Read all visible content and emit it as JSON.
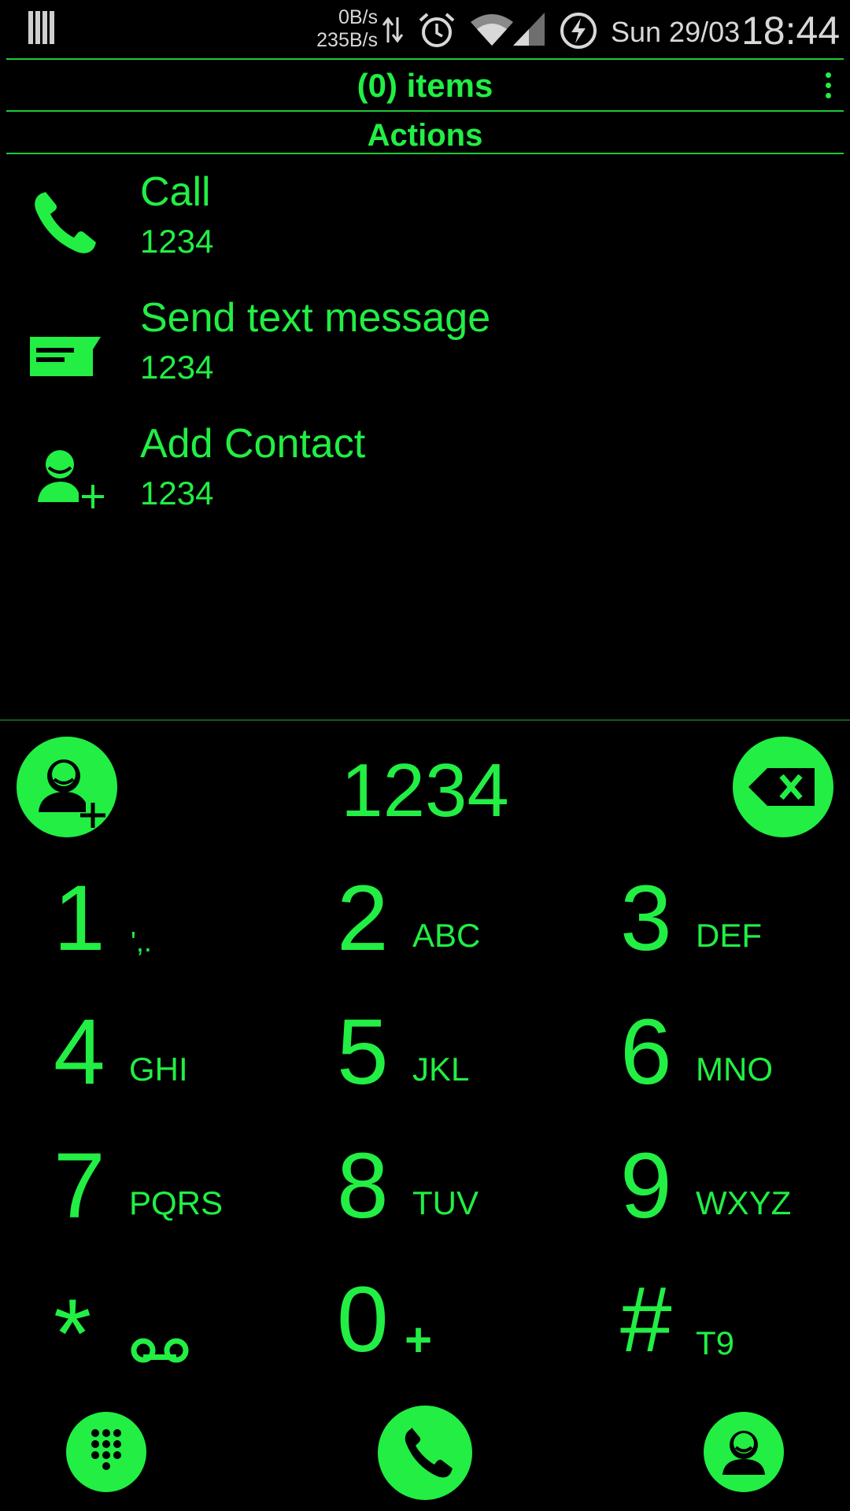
{
  "status_bar": {
    "net_down": "0B/s",
    "net_up": "235B/s",
    "date": "Sun 29/03",
    "time": "18:44"
  },
  "header": {
    "title": "(0) items"
  },
  "section": {
    "title": "Actions"
  },
  "actions": [
    {
      "title": "Call",
      "number": "1234",
      "icon": "phone-icon"
    },
    {
      "title": "Send text message",
      "number": "1234",
      "icon": "message-icon"
    },
    {
      "title": "Add Contact",
      "number": "1234",
      "icon": "add-contact-icon"
    }
  ],
  "dialer": {
    "entry": "1234",
    "keys": [
      {
        "digit": "1",
        "letters": "',."
      },
      {
        "digit": "2",
        "letters": "ABC"
      },
      {
        "digit": "3",
        "letters": "DEF"
      },
      {
        "digit": "4",
        "letters": "GHI"
      },
      {
        "digit": "5",
        "letters": "JKL"
      },
      {
        "digit": "6",
        "letters": "MNO"
      },
      {
        "digit": "7",
        "letters": "PQRS"
      },
      {
        "digit": "8",
        "letters": "TUV"
      },
      {
        "digit": "9",
        "letters": "WXYZ"
      },
      {
        "digit": "*",
        "letters": ""
      },
      {
        "digit": "0",
        "letters": "+"
      },
      {
        "digit": "#",
        "letters": "T9"
      }
    ]
  },
  "colors": {
    "accent": "#22ee44",
    "background": "#000000",
    "status_text": "#d8d8d8"
  }
}
